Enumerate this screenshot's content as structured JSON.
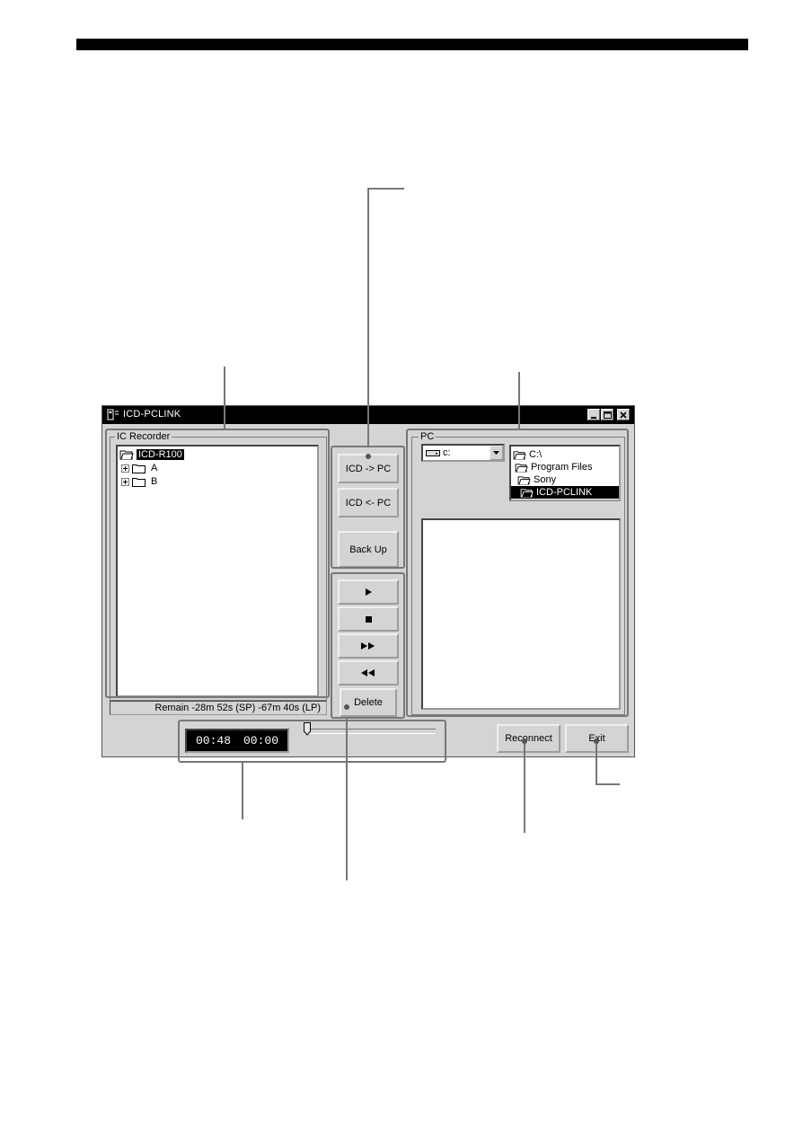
{
  "window": {
    "title": "ICD-PCLINK"
  },
  "ic_recorder": {
    "group_label": "IC Recorder",
    "tree": [
      {
        "label": "ICD-R100",
        "selected": true
      },
      {
        "label": "A"
      },
      {
        "label": "B"
      }
    ],
    "remain_text": "Remain -28m 52s (SP) -67m 40s (LP)"
  },
  "transfer": {
    "icd_to_pc": "ICD -> PC",
    "pc_to_icd": "ICD <- PC",
    "back_up": "Back Up"
  },
  "playback": {
    "play_icon": "play-icon",
    "stop_icon": "stop-icon",
    "fast_forward_icon": "fast-forward-icon",
    "rewind_icon": "rewind-icon",
    "delete": "Delete"
  },
  "pc": {
    "group_label": "PC",
    "drive_value": "c:",
    "folders": [
      {
        "label": "C:\\"
      },
      {
        "label": "Program Files"
      },
      {
        "label": "Sony"
      },
      {
        "label": "ICD-PCLINK",
        "selected": true
      }
    ]
  },
  "time": {
    "elapsed": "00:48",
    "position": "00:00"
  },
  "slider": {
    "position_fraction": 0.0
  },
  "bottom": {
    "reconnect": "Reconnect",
    "exit": "Exit"
  }
}
